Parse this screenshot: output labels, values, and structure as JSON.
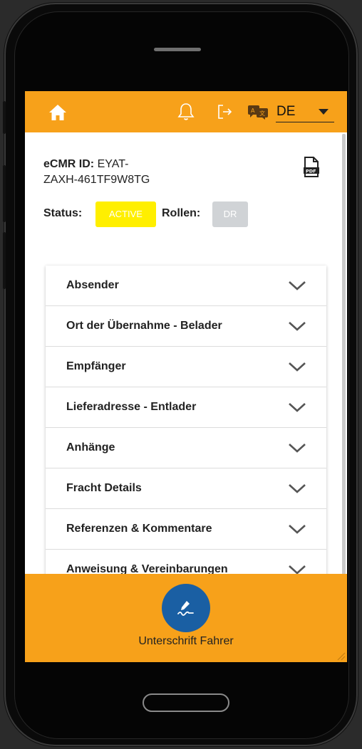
{
  "app": {
    "colors": {
      "accent": "#f7a11a",
      "active_badge": "#ffef00",
      "role_badge": "#d0d3d6",
      "sign_button": "#1a5fa3"
    }
  },
  "topbar": {
    "icons": [
      "home-icon",
      "bell-icon",
      "logout-icon",
      "language-icon"
    ],
    "language": "DE"
  },
  "document": {
    "id_label": "eCMR ID:",
    "id_line1": "EYAT-",
    "id_line2": "ZAXH-461TF9W8TG",
    "status_label": "Status:",
    "status_value": "ACTIVE",
    "roles_label": "Rollen:",
    "role_value": "DR",
    "pdf_icon": "pdf-icon"
  },
  "sections": [
    {
      "label": "Absender"
    },
    {
      "label": "Ort der Übernahme - Belader"
    },
    {
      "label": "Empfänger"
    },
    {
      "label": "Lieferadresse - Entlader"
    },
    {
      "label": "Anhänge"
    },
    {
      "label": "Fracht Details"
    },
    {
      "label": "Referenzen & Kommentare"
    },
    {
      "label": "Anweisung & Vereinbarungen"
    }
  ],
  "footer": {
    "sign_label": "Unterschrift Fahrer",
    "sign_icon": "pen-signature-icon"
  }
}
